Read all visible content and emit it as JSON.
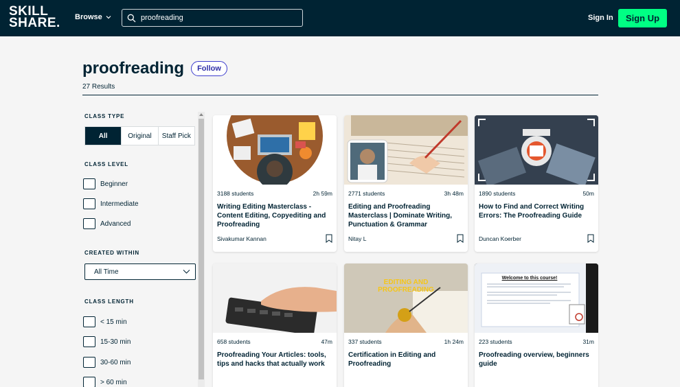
{
  "header": {
    "logo_line1": "SKILL",
    "logo_line2": "SHARE.",
    "browse_label": "Browse",
    "search_value": "proofreading",
    "signin_label": "Sign In",
    "signup_label": "Sign Up"
  },
  "page": {
    "title": "proofreading",
    "follow_label": "Follow",
    "results": "27 Results"
  },
  "filters": {
    "class_type": {
      "label": "CLASS TYPE",
      "options": [
        "All",
        "Original",
        "Staff Pick"
      ],
      "selected": "All"
    },
    "class_level": {
      "label": "CLASS LEVEL",
      "options": [
        "Beginner",
        "Intermediate",
        "Advanced"
      ]
    },
    "created_within": {
      "label": "CREATED WITHIN",
      "value": "All Time"
    },
    "class_length": {
      "label": "CLASS LENGTH",
      "options": [
        "< 15 min",
        "15-30 min",
        "30-60 min",
        "> 60 min"
      ]
    }
  },
  "cards": [
    {
      "students": "3188 students",
      "duration": "2h 59m",
      "title": "Writing Editing Masterclass - Content Editing, Copyediting and Proofreading",
      "author": "Sivakumar Kannan"
    },
    {
      "students": "2771 students",
      "duration": "3h 48m",
      "title": "Editing and Proofreading Masterclass | Dominate Writing, Punctuation & Grammar",
      "author": "Nitay L"
    },
    {
      "students": "1890 students",
      "duration": "50m",
      "title": "How to Find and Correct Writing Errors: The Proofreading Guide",
      "author": "Duncan Koerber"
    },
    {
      "students": "658 students",
      "duration": "47m",
      "title": "Proofreading Your Articles: tools, tips and hacks that actually work",
      "author": ""
    },
    {
      "students": "337 students",
      "duration": "1h 24m",
      "title": "Certification in Editing and Proofreading",
      "author": "",
      "thumb_text": "EDITING AND PROOFREADING"
    },
    {
      "students": "223 students",
      "duration": "31m",
      "title": "Proofreading overview, beginners guide",
      "author": "",
      "thumb_text": "Welcome to this course!"
    }
  ],
  "colors": {
    "brand_dark": "#002333",
    "brand_green": "#00ff84",
    "follow_purple": "#3c3ccd"
  }
}
